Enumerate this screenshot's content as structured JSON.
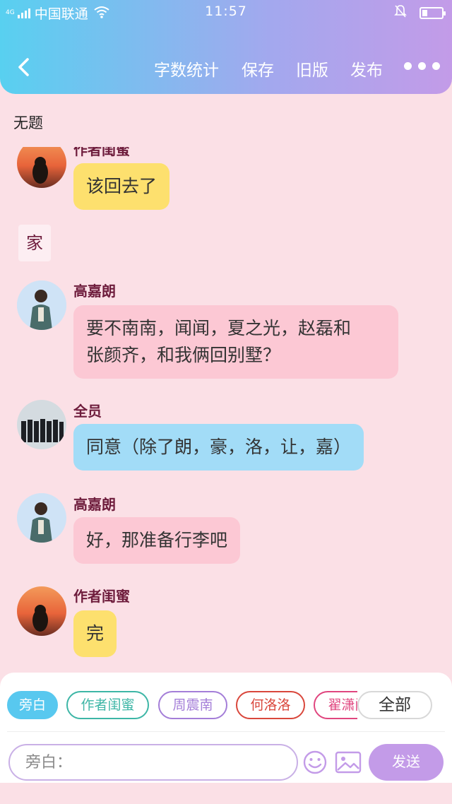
{
  "status_bar": {
    "network": "4G",
    "carrier": "中国联通",
    "time": "11:57",
    "battery_level": 0.25,
    "icons": [
      "signal-icon",
      "wifi-icon",
      "bell-muted-icon",
      "battery-icon"
    ]
  },
  "nav": {
    "back_icon": "chevron-left-icon",
    "word_count": "字数统计",
    "save": "保存",
    "old_version": "旧版",
    "publish": "发布",
    "more_icon": "more-dots-icon"
  },
  "page": {
    "title": "无题"
  },
  "messages": [
    {
      "sender": "作者闺蜜",
      "text": "该回去了",
      "color": "#fde06e"
    },
    {
      "scene": "家"
    },
    {
      "sender": "高嘉朗",
      "text_line1": "要不南南，闻闻，夏之光，赵磊和",
      "text_line2": "张颜齐，和我俩回别墅？",
      "color": "#fcc8d4"
    },
    {
      "sender": "全员",
      "text": "同意（除了朗，豪，洛，让，嘉）",
      "color": "#a2dcf7"
    },
    {
      "sender": "高嘉朗",
      "text": "好，那准备行李吧",
      "color": "#fcc8d4"
    },
    {
      "sender": "作者闺蜜",
      "text": "完",
      "color": "#fde06e"
    }
  ],
  "roles": [
    {
      "label": "旁白",
      "color": "#58c8ef",
      "selected": true
    },
    {
      "label": "作者闺蜜",
      "color": "#3db6a6"
    },
    {
      "label": "周震南",
      "color": "#a47ed8"
    },
    {
      "label": "何洛洛",
      "color": "#d9473c"
    },
    {
      "label": "翟潇闻",
      "color": "#e0467f"
    }
  ],
  "composer": {
    "all_label": "全部",
    "placeholder": "旁白：",
    "send_label": "发送",
    "emoji_icon": "smiley-icon",
    "image_icon": "image-icon",
    "accent": "#c39be8"
  }
}
